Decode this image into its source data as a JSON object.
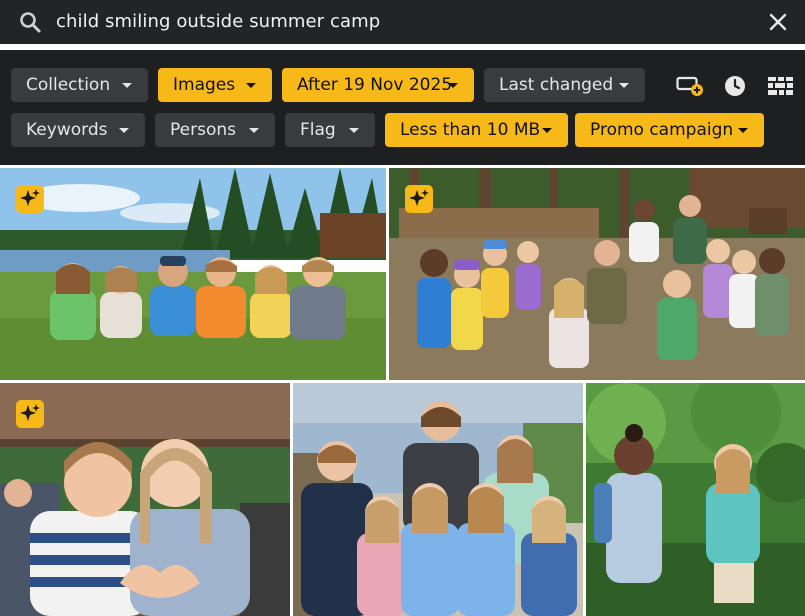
{
  "search": {
    "query": "child smiling outside summer camp",
    "search_icon": "search-icon",
    "clear_icon": "close-icon"
  },
  "filters": {
    "row1": [
      {
        "label": "Collection",
        "active": false
      },
      {
        "label": "Images",
        "active": true
      },
      {
        "label": "After 19 Nov 2025",
        "active": true
      },
      {
        "label": "Last changed",
        "active": false
      }
    ],
    "row2": [
      {
        "label": "Keywords",
        "active": false
      },
      {
        "label": "Persons",
        "active": false
      },
      {
        "label": "Flag",
        "active": false
      },
      {
        "label": "Less than 10 MB",
        "active": true
      },
      {
        "label": "Promo campaign",
        "active": true
      }
    ],
    "tools": [
      "add-to-collection-icon",
      "clock-icon",
      "grid-view-icon"
    ]
  },
  "results": {
    "photos": [
      {
        "id": "photo-lake-group",
        "ai_generated": true
      },
      {
        "id": "photo-ranger-circle",
        "ai_generated": true
      },
      {
        "id": "photo-heart-hands",
        "ai_generated": true
      },
      {
        "id": "photo-group-shells",
        "ai_generated": false
      },
      {
        "id": "photo-forest-girls",
        "ai_generated": false
      }
    ],
    "badge_icon": "sparkle-icon"
  },
  "colors": {
    "accent": "#f7b917",
    "chip_dark": "#3a3b3e",
    "panel_bg": "#1e1f21",
    "search_bg": "#232427"
  }
}
